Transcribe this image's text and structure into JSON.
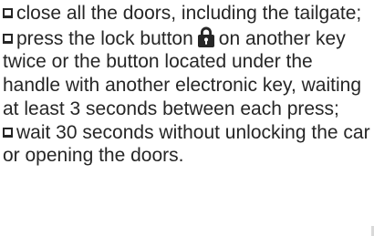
{
  "items": [
    {
      "text": "close all the doors, including the tailgate;"
    },
    {
      "text_before": "press the lock button",
      "icon": "padlock-icon",
      "text_after": "on another key twice or the button located under the handle with another electronic key, waiting at least 3 seconds between each press;"
    },
    {
      "text": "wait 30 seconds without unlocking the car or opening the doors."
    }
  ],
  "colors": {
    "text": "#262626",
    "background": "#ffffff"
  }
}
